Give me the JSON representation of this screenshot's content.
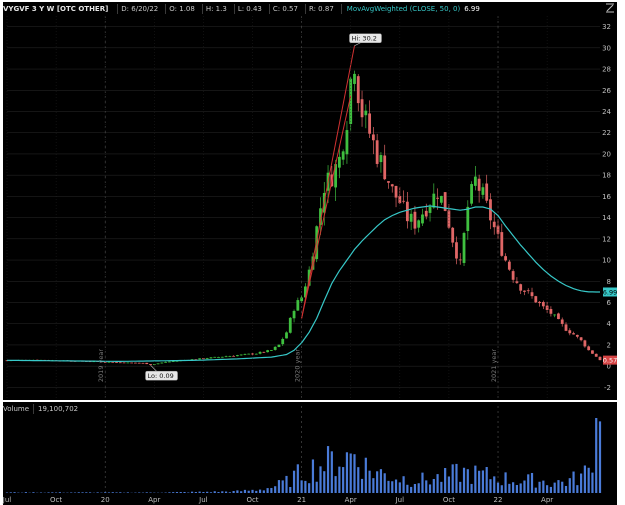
{
  "header": {
    "symbol": "VYGVF 3 Y W [OTC OTHER]",
    "date": "D: 6/20/22",
    "open": "O: 1.08",
    "high": "H: 1.3",
    "low": "L: 0.43",
    "close": "C: 0.57",
    "range": "R: 0.87",
    "study": "MovAvgWeighted (CLOSE, 50, 0)",
    "study_value": "6.99"
  },
  "volume_header": {
    "label": "Volume",
    "value": "19,100,702"
  },
  "colors": {
    "background": "#000000",
    "up": "#3fbf3f",
    "down": "#e06666",
    "ma": "#37c8c8",
    "grid": "#2a2a2a",
    "axis_text": "#bfbfbf",
    "volume": "#4a7bd8",
    "trendline": "#d23232"
  },
  "chart_data": {
    "type": "candlestick",
    "interval": "weekly",
    "x_axis": {
      "tick_labels": [
        "Jul",
        "Oct",
        "20",
        "Apr",
        "Jul",
        "Oct",
        "21",
        "Apr",
        "Jul",
        "Oct",
        "22",
        "Apr"
      ],
      "tick_weeks": [
        0,
        13,
        26,
        39,
        52,
        65,
        78,
        91,
        104,
        117,
        130,
        143
      ],
      "year_markers": [
        "2019 year",
        "2020 year",
        "2021 year"
      ],
      "year_marker_weeks": [
        26,
        78,
        130
      ]
    },
    "y_axis": {
      "ylim": [
        -3,
        33
      ],
      "ticks": [
        -2,
        0,
        2,
        4,
        6,
        8,
        10,
        12,
        14,
        16,
        18,
        20,
        22,
        24,
        26,
        28,
        30,
        32
      ]
    },
    "last_price_label": "0.57",
    "ma_price_label": "6.99",
    "annotations": [
      {
        "text": "Hi: 30.2",
        "week": 92,
        "price": 30.2
      },
      {
        "text": "Lo: 0.09",
        "week": 38,
        "price": 0.09
      }
    ],
    "price_path": [
      [
        0,
        0.55
      ],
      [
        8,
        0.6
      ],
      [
        16,
        0.5
      ],
      [
        24,
        0.45
      ],
      [
        30,
        0.35
      ],
      [
        36,
        0.3
      ],
      [
        38,
        0.12
      ],
      [
        42,
        0.4
      ],
      [
        48,
        0.6
      ],
      [
        54,
        0.8
      ],
      [
        60,
        1.0
      ],
      [
        66,
        1.2
      ],
      [
        70,
        1.5
      ],
      [
        72,
        2.0
      ],
      [
        74,
        3.2
      ],
      [
        76,
        5.5
      ],
      [
        78,
        6.5
      ],
      [
        80,
        9.0
      ],
      [
        82,
        13.0
      ],
      [
        84,
        17.0
      ],
      [
        86,
        18.0
      ],
      [
        88,
        19.5
      ],
      [
        90,
        23.5
      ],
      [
        91,
        27.0
      ],
      [
        92,
        29.0
      ],
      [
        93,
        26.0
      ],
      [
        94,
        24.0
      ],
      [
        96,
        22.0
      ],
      [
        98,
        20.0
      ],
      [
        100,
        18.5
      ],
      [
        102,
        16.5
      ],
      [
        104,
        15.5
      ],
      [
        106,
        14.0
      ],
      [
        108,
        13.5
      ],
      [
        110,
        14.5
      ],
      [
        112,
        15.5
      ],
      [
        114,
        16.5
      ],
      [
        116,
        15.0
      ],
      [
        118,
        12.0
      ],
      [
        120,
        9.5
      ],
      [
        122,
        15.0
      ],
      [
        124,
        17.5
      ],
      [
        126,
        16.0
      ],
      [
        128,
        14.0
      ],
      [
        130,
        12.0
      ],
      [
        132,
        10.0
      ],
      [
        134,
        8.5
      ],
      [
        136,
        7.5
      ],
      [
        138,
        6.8
      ],
      [
        140,
        6.2
      ],
      [
        142,
        5.5
      ],
      [
        144,
        5.0
      ],
      [
        146,
        4.2
      ],
      [
        148,
        3.5
      ],
      [
        150,
        3.0
      ],
      [
        152,
        2.4
      ],
      [
        154,
        1.5
      ],
      [
        156,
        0.9
      ],
      [
        157,
        0.57
      ]
    ],
    "ma_path": [
      [
        0,
        0.55
      ],
      [
        30,
        0.45
      ],
      [
        50,
        0.55
      ],
      [
        62,
        0.7
      ],
      [
        70,
        0.85
      ],
      [
        74,
        1.1
      ],
      [
        76,
        1.5
      ],
      [
        78,
        2.2
      ],
      [
        80,
        3.2
      ],
      [
        82,
        4.5
      ],
      [
        84,
        6.2
      ],
      [
        86,
        7.8
      ],
      [
        88,
        9.0
      ],
      [
        90,
        10.0
      ],
      [
        92,
        11.0
      ],
      [
        94,
        11.8
      ],
      [
        96,
        12.5
      ],
      [
        98,
        13.2
      ],
      [
        100,
        13.8
      ],
      [
        102,
        14.2
      ],
      [
        104,
        14.5
      ],
      [
        106,
        14.7
      ],
      [
        108,
        14.9
      ],
      [
        110,
        15.0
      ],
      [
        112,
        15.1
      ],
      [
        114,
        15.0
      ],
      [
        116,
        14.9
      ],
      [
        118,
        14.8
      ],
      [
        120,
        14.7
      ],
      [
        122,
        14.8
      ],
      [
        124,
        15.0
      ],
      [
        126,
        15.0
      ],
      [
        128,
        14.8
      ],
      [
        130,
        14.2
      ],
      [
        132,
        13.2
      ],
      [
        134,
        12.3
      ],
      [
        136,
        11.4
      ],
      [
        138,
        10.6
      ],
      [
        140,
        9.8
      ],
      [
        142,
        9.1
      ],
      [
        144,
        8.5
      ],
      [
        146,
        8.0
      ],
      [
        148,
        7.6
      ],
      [
        150,
        7.3
      ],
      [
        152,
        7.1
      ],
      [
        154,
        7.0
      ],
      [
        156,
        6.99
      ],
      [
        157,
        6.99
      ]
    ],
    "volume": {
      "ylim": [
        0,
        20000000
      ],
      "last": 19100702,
      "path": [
        [
          0,
          150000
        ],
        [
          40,
          120000
        ],
        [
          60,
          400000
        ],
        [
          66,
          800000
        ],
        [
          70,
          1500000
        ],
        [
          74,
          3000000
        ],
        [
          78,
          5500000
        ],
        [
          82,
          7000000
        ],
        [
          86,
          8500000
        ],
        [
          90,
          9500000
        ],
        [
          92,
          10500000
        ],
        [
          96,
          6000000
        ],
        [
          100,
          5000000
        ],
        [
          104,
          4000000
        ],
        [
          110,
          3500000
        ],
        [
          116,
          4200000
        ],
        [
          120,
          5500000
        ],
        [
          124,
          5000000
        ],
        [
          128,
          4500000
        ],
        [
          132,
          3800000
        ],
        [
          136,
          3200000
        ],
        [
          140,
          3500000
        ],
        [
          144,
          2800000
        ],
        [
          148,
          3000000
        ],
        [
          152,
          4500000
        ],
        [
          154,
          6000000
        ],
        [
          156,
          19100702
        ]
      ]
    },
    "trendlines": [
      {
        "from": {
          "week": 78,
          "price": 4.5
        },
        "to": {
          "week": 92,
          "price": 30.2
        }
      },
      {
        "from": {
          "week": 78,
          "price": 4.5
        },
        "to": {
          "week": 91,
          "price": 25.5
        }
      }
    ]
  }
}
